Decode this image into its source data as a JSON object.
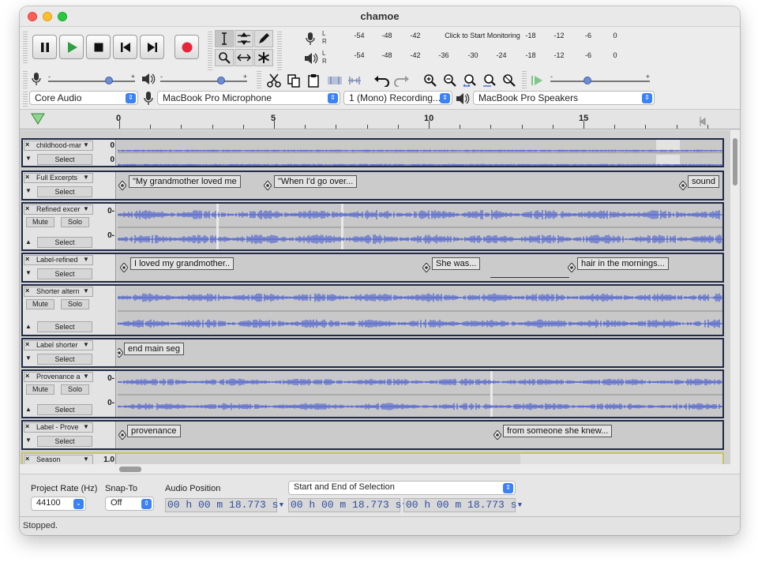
{
  "window": {
    "title": "chamoe"
  },
  "meters": {
    "record_ticks": [
      "-54",
      "-48",
      "-42",
      "-18",
      "-12",
      "-6",
      "0"
    ],
    "record_prompt": "Click to Start Monitoring",
    "play_ticks": [
      "-54",
      "-48",
      "-42",
      "-36",
      "-30",
      "-24",
      "-18",
      "-12",
      "-6",
      "0"
    ],
    "left_channel": "L",
    "right_channel": "R"
  },
  "sliders": {
    "minus": "-",
    "plus": "+",
    "mic_level": 0.72,
    "speaker_level": 0.72,
    "play_speed": 0.36
  },
  "devices": {
    "host": "Core Audio",
    "input_device": "MacBook Pro Microphone",
    "channels": "1 (Mono) Recording...",
    "output_device": "MacBook Pro Speakers"
  },
  "ruler": {
    "marks": [
      "0",
      "5",
      "10",
      "15"
    ]
  },
  "track_common": {
    "close": "×",
    "select": "Select",
    "mute": "Mute",
    "solo": "Solo",
    "dropdown": "▼",
    "collapse_up": "▲",
    "collapse_down": "▼",
    "wave_zero": "0-"
  },
  "tracks": [
    {
      "name": "childhood-mar",
      "scale_top": "0",
      "scale_bottom": "0"
    },
    {
      "name": "Full Excerpts",
      "labels": [
        "\"My grandmother loved me",
        "\"When I'd go over...",
        "sound"
      ]
    },
    {
      "name": "Refined excer"
    },
    {
      "name": "Label-refined",
      "labels": [
        "I loved my grandmother..",
        "She was...",
        "hair in the mornings..."
      ]
    },
    {
      "name": "Shorter altern"
    },
    {
      "name": "Label shorter",
      "labels": [
        "end main seg"
      ]
    },
    {
      "name": "Provenance a"
    },
    {
      "name": "Label - Prove",
      "labels": [
        "provenance",
        "from someone she knew..."
      ]
    },
    {
      "name": "Season",
      "scale_top": "1.0"
    }
  ],
  "bottom": {
    "project_rate_label": "Project Rate (Hz)",
    "project_rate": "44100",
    "snap_label": "Snap-To",
    "snap_value": "Off",
    "audio_position_label": "Audio Position",
    "audio_position": "00 h 00 m 18.773 s",
    "selection_mode": "Start and End of Selection",
    "selection_start": "00 h 00 m 18.773 s",
    "selection_end": "00 h 00 m 18.773 s"
  },
  "status": "Stopped.",
  "colors": {
    "waveform": "#4a5fd0",
    "track_border": "#202a47",
    "record": "#e8263a",
    "play": "#2ea043",
    "accent": "#3b82f6"
  }
}
